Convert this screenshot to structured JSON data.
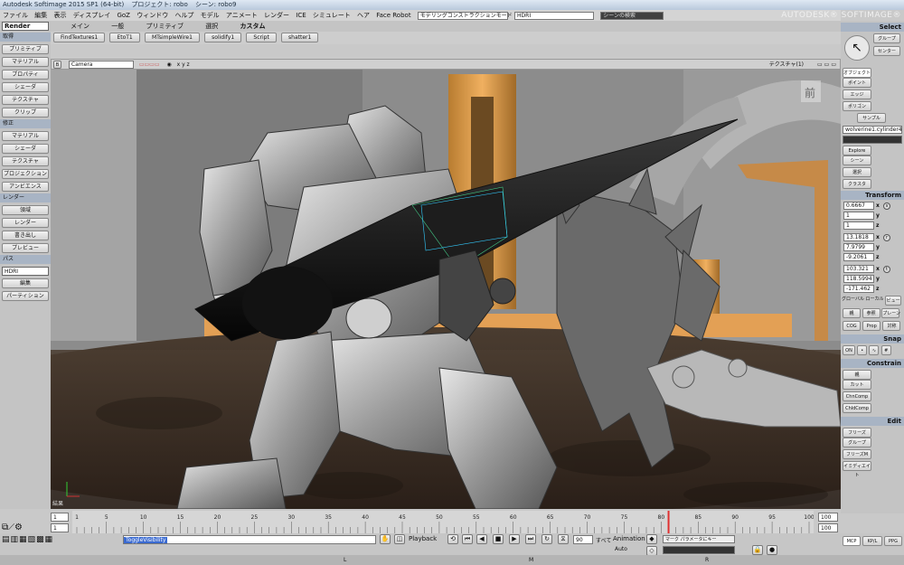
{
  "title": {
    "app": "Autodesk Softimage 2015 SP1 (64-bit)",
    "project": "プロジェクト: robo",
    "scene": "シーン: robo9"
  },
  "menu": [
    "ファイル",
    "編集",
    "表示",
    "ディスプレイ",
    "GoZ",
    "ウィンドウ",
    "ヘルプ",
    "モデル",
    "アニメート",
    "レンダー",
    "ICE",
    "シミュレート",
    "ヘア",
    "Face Robot"
  ],
  "menu_combos": {
    "mode": "モデリングコンストラクションモード",
    "pass": "HDRI",
    "search": "シーンの検索"
  },
  "brand": "AUTODESK® SOFTIMAGE®",
  "top_tabs": [
    "メイン",
    "一般",
    "プリミティブ",
    "選択",
    "カスタム"
  ],
  "shelf": [
    "FindTextures1",
    "EtoT1",
    "MTsimpleWire1",
    "solidify1",
    "Script",
    "shatter1"
  ],
  "left": {
    "module": "Render",
    "sections": [
      {
        "head": "取得",
        "items": [
          "プリミティブ",
          "マテリアル",
          "プロパティ",
          "シェーダ",
          "テクスチャ",
          "クリップ"
        ]
      },
      {
        "head": "修正",
        "items": [
          "マテリアル",
          "シェーダ",
          "テクスチャ",
          "プロジェクション",
          "アンビエンス"
        ]
      },
      {
        "head": "レンダー",
        "items": [
          "領域",
          "レンダー",
          "書き出し",
          "プレビュー"
        ]
      },
      {
        "head": "パス",
        "items": [
          "編集",
          "パーティション"
        ]
      }
    ],
    "pass_select": "HDRI"
  },
  "viewport": {
    "camera": "Camera",
    "axes": "x y z",
    "texture_label": "テクスチャ(1)",
    "status": "結果"
  },
  "right": {
    "select_head": "Select",
    "group": "グループ",
    "center": "センター",
    "object": "オブジェクト",
    "point": "ポイント",
    "edge": "エッジ",
    "polygon": "ポリゴン",
    "sample": "サンプル",
    "selection": "wolverine1.cylinder4",
    "explore": "Explore",
    "scene": "シーン",
    "select": "選択",
    "cluster": "クラスタ",
    "transform_head": "Transform",
    "scale": [
      "0.6667",
      "1",
      "1"
    ],
    "rotate": [
      "13.1818",
      "7.9799",
      "-9.2061"
    ],
    "translate": [
      "103.321",
      "118.5994",
      "-171.462"
    ],
    "axes": [
      "x",
      "y",
      "z"
    ],
    "global": "グローバル",
    "local": "ローカル",
    "view": "ビュー",
    "par": "親",
    "ref": "参照",
    "plane": "プレーン",
    "cog": "COG",
    "prop": "Prop",
    "sym": "対称",
    "snap_head": "Snap",
    "snap_on": "ON",
    "constrain_head": "Constrain",
    "parent": "親",
    "cut": "カット",
    "chncomp": "ChnComp",
    "childcomp": "ChldComp",
    "edit_head": "Edit",
    "freeze": "フリーズ",
    "group2": "グループ",
    "freezeall": "フリーズM",
    "immed": "イミディエイト"
  },
  "timeline": {
    "start": "1",
    "start2": "1",
    "end": "100",
    "end2": "100",
    "ticks": [
      "1",
      "5",
      "10",
      "15",
      "20",
      "25",
      "30",
      "35",
      "40",
      "45",
      "50",
      "55",
      "60",
      "65",
      "70",
      "75",
      "80",
      "85",
      "90",
      "95",
      "100"
    ],
    "current": "81"
  },
  "bottom": {
    "command": "ToggleVisibility",
    "playback": "Playback",
    "fps": "90",
    "all": "すべて",
    "animation": "Animation",
    "auto": "Auto",
    "mark": "マーク パラメータにキー",
    "tabs": [
      "MCP",
      "KP/L",
      "PPG"
    ],
    "bottom_letters": [
      "L",
      "M",
      "R"
    ]
  },
  "colors": {
    "accent": "#a8b4c4",
    "panel": "#c4c4c4"
  }
}
